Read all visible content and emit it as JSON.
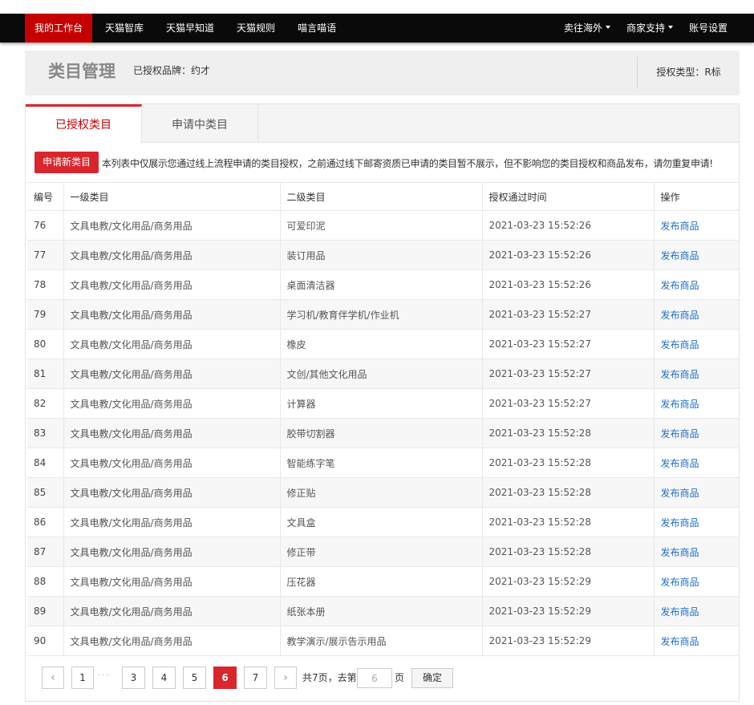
{
  "topnav": {
    "left": [
      "我的工作台",
      "天猫智库",
      "天猫早知道",
      "天猫规则",
      "喵言喵语"
    ],
    "right": [
      {
        "label": "卖往海外",
        "has_dropdown": true
      },
      {
        "label": "商家支持",
        "has_dropdown": true
      },
      {
        "label": "账号设置",
        "has_dropdown": false
      }
    ],
    "active_index": 0
  },
  "header": {
    "title": "类目管理",
    "brand_label": "已授权品牌：约才",
    "auth_type": "授权类型：R标"
  },
  "tabs": [
    "已授权类目",
    "申请中类目"
  ],
  "active_tab": 0,
  "notice": {
    "button": "申请新类目",
    "text": "本列表中仅展示您通过线上流程申请的类目授权，之前通过线下邮寄资质已申请的类目暂不展示，但不影响您的类目授权和商品发布，请勿重复申请!"
  },
  "table": {
    "headers": [
      "编号",
      "一级类目",
      "二级类目",
      "授权通过时间",
      "操作"
    ],
    "action_label": "发布商品",
    "rows": [
      [
        "76",
        "文具电教/文化用品/商务用品",
        "可爱印泥",
        "2021-03-23 15:52:26"
      ],
      [
        "77",
        "文具电教/文化用品/商务用品",
        "装订用品",
        "2021-03-23 15:52:26"
      ],
      [
        "78",
        "文具电教/文化用品/商务用品",
        "桌面清洁器",
        "2021-03-23 15:52:26"
      ],
      [
        "79",
        "文具电教/文化用品/商务用品",
        "学习机/教育伴学机/作业机",
        "2021-03-23 15:52:27"
      ],
      [
        "80",
        "文具电教/文化用品/商务用品",
        "橡皮",
        "2021-03-23 15:52:27"
      ],
      [
        "81",
        "文具电教/文化用品/商务用品",
        "文创/其他文化用品",
        "2021-03-23 15:52:27"
      ],
      [
        "82",
        "文具电教/文化用品/商务用品",
        "计算器",
        "2021-03-23 15:52:27"
      ],
      [
        "83",
        "文具电教/文化用品/商务用品",
        "胶带切割器",
        "2021-03-23 15:52:28"
      ],
      [
        "84",
        "文具电教/文化用品/商务用品",
        "智能练字笔",
        "2021-03-23 15:52:28"
      ],
      [
        "85",
        "文具电教/文化用品/商务用品",
        "修正贴",
        "2021-03-23 15:52:28"
      ],
      [
        "86",
        "文具电教/文化用品/商务用品",
        "文具盒",
        "2021-03-23 15:52:28"
      ],
      [
        "87",
        "文具电教/文化用品/商务用品",
        "修正带",
        "2021-03-23 15:52:28"
      ],
      [
        "88",
        "文具电教/文化用品/商务用品",
        "压花器",
        "2021-03-23 15:52:29"
      ],
      [
        "89",
        "文具电教/文化用品/商务用品",
        "纸张本册",
        "2021-03-23 15:52:29"
      ],
      [
        "90",
        "文具电教/文化用品/商务用品",
        "教学演示/展示告示用品",
        "2021-03-23 15:52:29"
      ]
    ]
  },
  "pagination": {
    "prev_icon": "chevron-left-icon",
    "next_icon": "chevron-right-icon",
    "first": "1",
    "ellipsis": "···",
    "pages": [
      "3",
      "4",
      "5",
      "6",
      "7"
    ],
    "current": "6",
    "total_text": "共7页，去第",
    "goto_value": "6",
    "page_suffix": "页",
    "confirm": "确定"
  },
  "colors": {
    "topbar_bg": "#0a0a0a",
    "accent_red": "#d9262c",
    "link_blue": "#1d6ec6"
  }
}
